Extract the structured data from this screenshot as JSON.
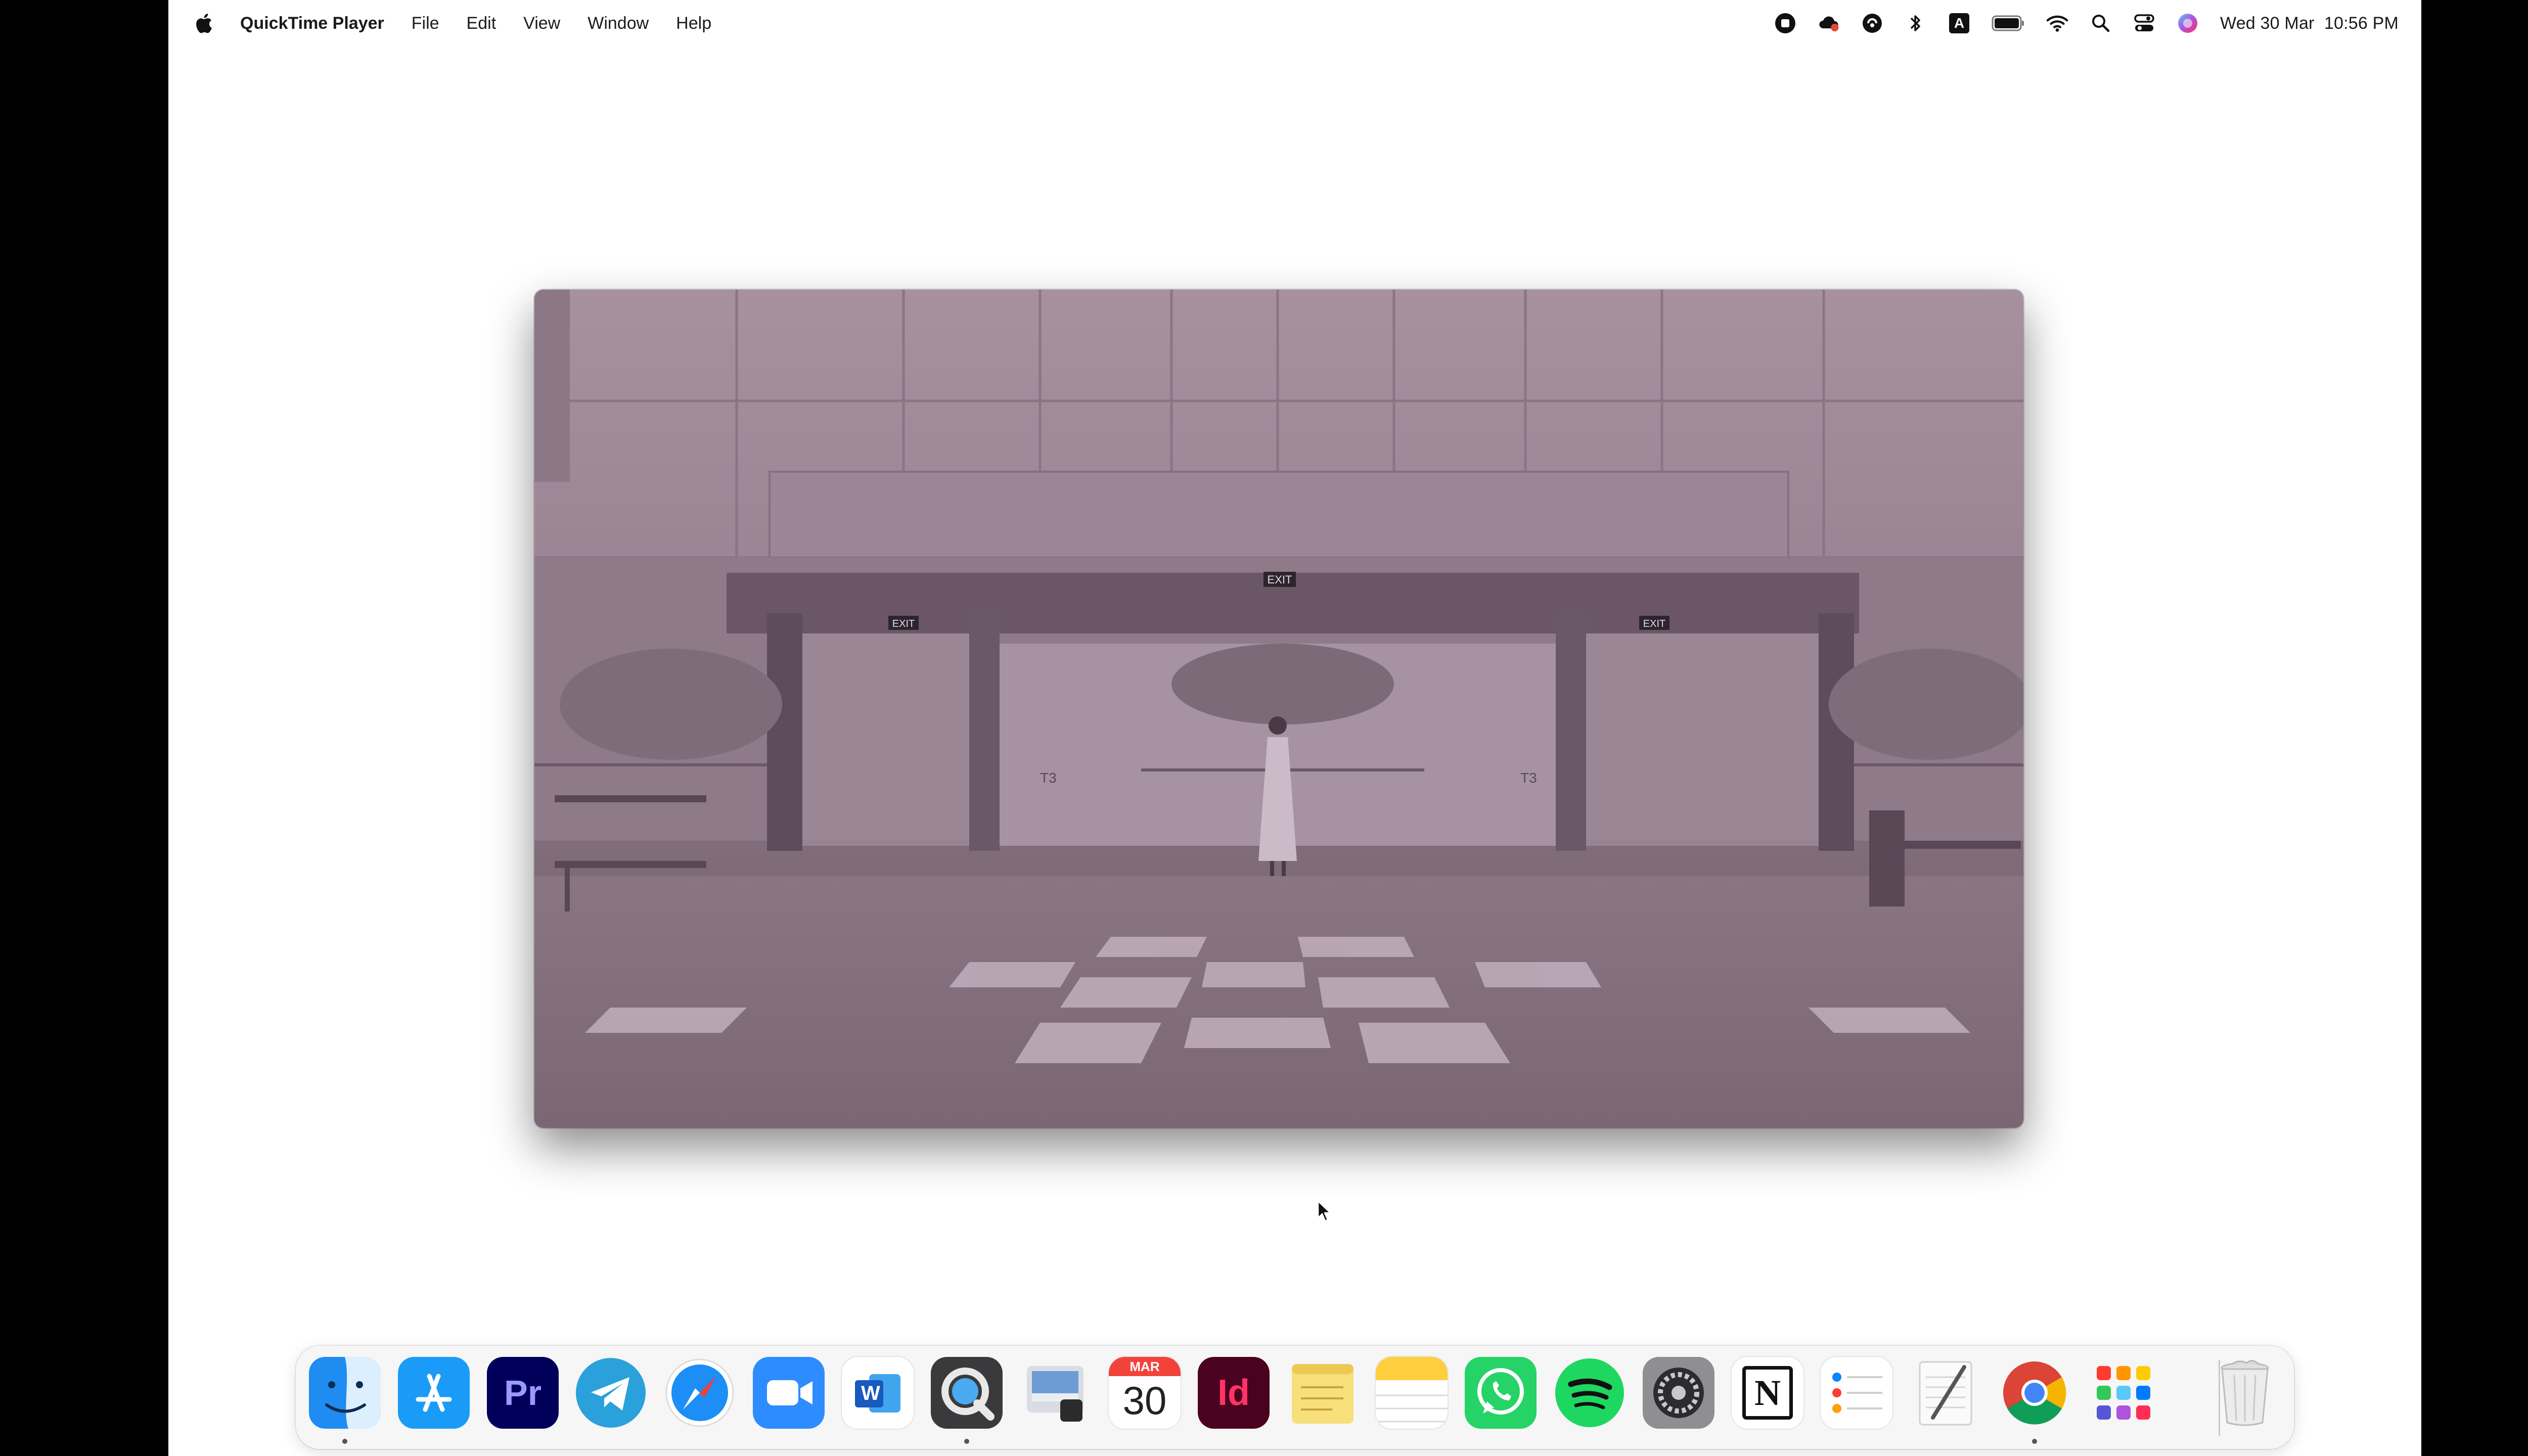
{
  "menubar": {
    "app_name": "QuickTime Player",
    "menus": [
      "File",
      "Edit",
      "View",
      "Window",
      "Help"
    ],
    "status_icons": [
      "screen-record-icon",
      "creative-cloud-icon",
      "vpn-icon",
      "bluetooth-icon",
      "input-source-icon",
      "battery-icon",
      "wifi-icon",
      "spotlight-icon",
      "control-center-icon",
      "siri-icon"
    ],
    "input_source_letter": "A",
    "clock": "Wed 30 Mar  10:56 PM"
  },
  "video": {
    "exit_signs": [
      "EXIT",
      "EXIT",
      "EXIT"
    ],
    "terminal_labels": [
      "T3",
      "T3"
    ],
    "scene_palette": {
      "tint": "#a08a9c",
      "glass": "#8e7a8b",
      "floor": "#7f6b7a",
      "floor_light": "#c4b2c0"
    }
  },
  "dock": {
    "apps": [
      {
        "name": "Finder",
        "icon": "finder-icon",
        "running": true
      },
      {
        "name": "App Store",
        "icon": "app-store-icon",
        "running": false
      },
      {
        "name": "Adobe Premiere Pro",
        "icon": "premiere-icon",
        "label": "Pr",
        "running": false
      },
      {
        "name": "Telegram",
        "icon": "telegram-icon",
        "running": false
      },
      {
        "name": "Safari",
        "icon": "safari-icon",
        "running": false
      },
      {
        "name": "Zoom",
        "icon": "zoom-icon",
        "running": false
      },
      {
        "name": "Microsoft Word",
        "icon": "word-icon",
        "label": "W",
        "running": false
      },
      {
        "name": "QuickTime Player",
        "icon": "quicktime-icon",
        "running": true
      },
      {
        "name": "Preview",
        "icon": "preview-icon",
        "running": false
      },
      {
        "name": "Calendar",
        "icon": "calendar-icon",
        "month": "MAR",
        "day": "30",
        "running": false
      },
      {
        "name": "Adobe InDesign",
        "icon": "indesign-icon",
        "label": "Id",
        "running": false
      },
      {
        "name": "Stickies",
        "icon": "stickies-icon",
        "running": false
      },
      {
        "name": "Notes",
        "icon": "notes-icon",
        "running": false
      },
      {
        "name": "WhatsApp",
        "icon": "whatsapp-icon",
        "running": false
      },
      {
        "name": "Spotify",
        "icon": "spotify-icon",
        "running": false
      },
      {
        "name": "System Preferences",
        "icon": "system-preferences-icon",
        "running": false
      },
      {
        "name": "Notion",
        "icon": "notion-icon",
        "label": "N",
        "running": false
      },
      {
        "name": "Reminders",
        "icon": "reminders-icon",
        "running": false
      },
      {
        "name": "TextEdit",
        "icon": "textedit-icon",
        "running": false
      },
      {
        "name": "Google Chrome",
        "icon": "chrome-icon",
        "running": true
      },
      {
        "name": "Launchpad",
        "icon": "launchpad-icon",
        "running": false
      }
    ],
    "trash": {
      "name": "Trash",
      "icon": "trash-icon"
    }
  },
  "colors": {
    "premiere_bg": "#00005b",
    "premiere_fg": "#9999ff",
    "indesign_bg": "#49021f",
    "indesign_fg": "#ff3366",
    "zoom": "#2d8cff",
    "telegram": "#2aa1da",
    "whatsapp": "#25d366",
    "spotify": "#1ed760"
  }
}
